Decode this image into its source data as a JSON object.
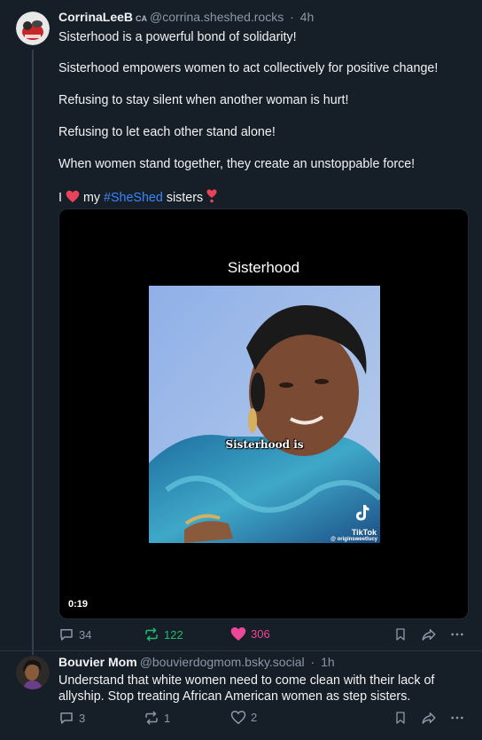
{
  "post1": {
    "author_name": "CorrinaLeeB",
    "badge": "CA",
    "handle": "@corrina.sheshed.rocks",
    "time": "4h",
    "lines": [
      "Sisterhood is a powerful bond of solidarity!",
      "Sisterhood empowers women to act collectively for positive change!",
      "Refusing to stay silent when another woman is hurt!",
      "Refusing to let each other stand alone!",
      "When women stand together, they create an unstoppable force!"
    ],
    "last_line": {
      "prefix": "I",
      "mid": "my",
      "hashtag": "#SheShed",
      "suffix": "sisters"
    },
    "video": {
      "title": "Sisterhood",
      "caption": "Sisterhood is",
      "tiktok_label": "TikTok",
      "tiktok_user": "@ originsweetlucy",
      "duration": "0:19"
    },
    "counts": {
      "replies": "34",
      "reposts": "122",
      "likes": "306"
    }
  },
  "post2": {
    "author_name": "Bouvier Mom",
    "handle": "@bouvierdogmom.bsky.social",
    "time": "1h",
    "lines": [
      "Understand that white women need to come clean with their lack of",
      "allyship.  Stop treating African American women as step sisters."
    ],
    "counts": {
      "replies": "3",
      "reposts": "1",
      "likes": "2"
    }
  },
  "colors": {
    "background": "#161e27",
    "hashtag": "#3a86ff",
    "repost_active": "#20bc6b",
    "like_active": "#ec4899",
    "muted": "#8a98a8"
  }
}
